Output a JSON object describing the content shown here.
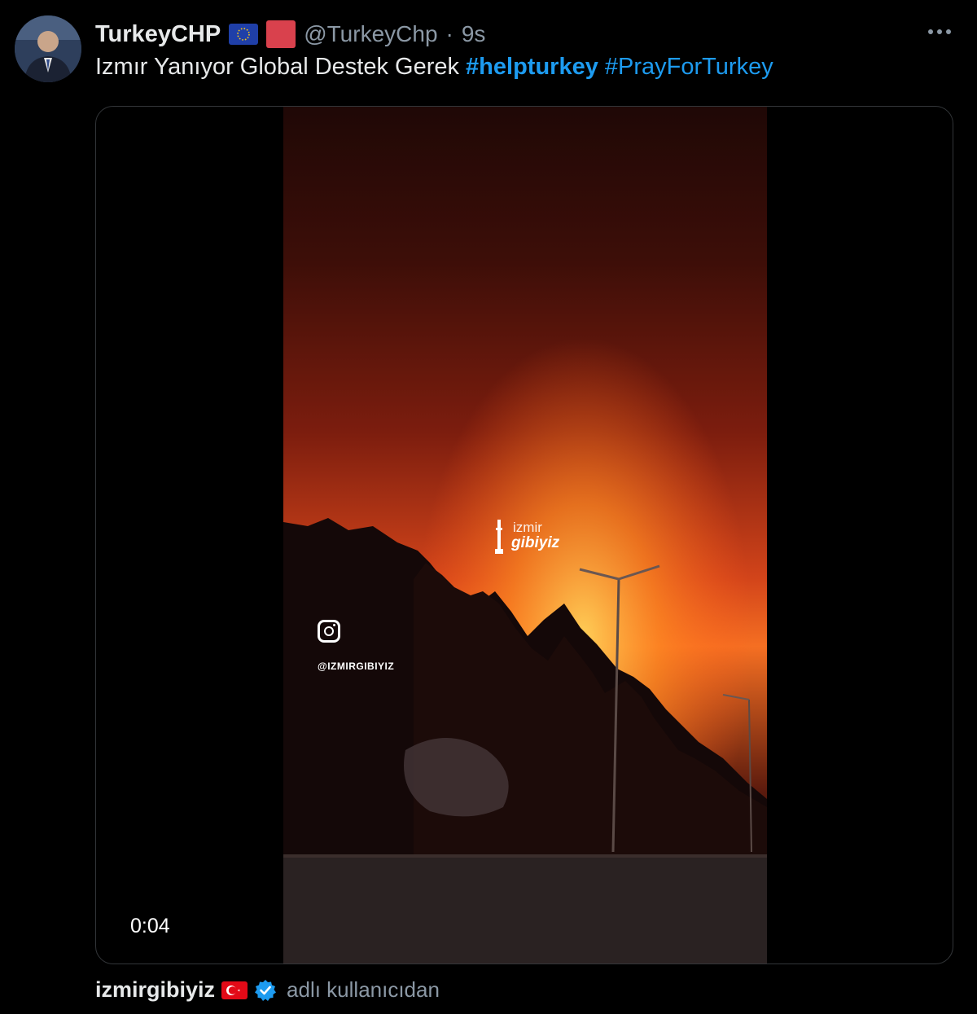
{
  "tweet": {
    "display_name": "TurkeyCHP",
    "handle": "@TurkeyChp",
    "separator": "·",
    "time": "9s",
    "text": "Izmır Yanıyor Global Destek Gerek",
    "hashtags": [
      "#helpturkey",
      "#PrayForTurkey"
    ],
    "more_icon": "more-horizontal-icon"
  },
  "media": {
    "type": "video",
    "timestamp": "0:04",
    "instagram_handle": "@IZMIRGIBIYIZ",
    "watermark_line1": "izmir",
    "watermark_line2": "gibiyiz"
  },
  "credit": {
    "user": "izmirgibiyiz",
    "suffix": "adlı kullanıcıdan"
  },
  "colors": {
    "background": "#000000",
    "text": "#e7e9ea",
    "secondary": "#8b98a5",
    "link": "#1d9bf0",
    "verified": "#1d9bf0"
  }
}
